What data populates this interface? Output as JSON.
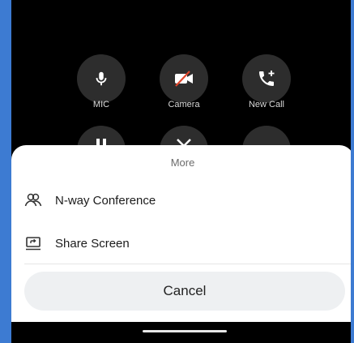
{
  "call_controls": [
    {
      "label": "MIC",
      "icon": "mic-icon"
    },
    {
      "label": "Camera",
      "icon": "camera-off-icon"
    },
    {
      "label": "New Call",
      "icon": "add-call-icon"
    }
  ],
  "sheet": {
    "title": "More",
    "options": [
      {
        "label": "N-way Conference",
        "icon": "conference-icon"
      },
      {
        "label": "Share Screen",
        "icon": "share-screen-icon"
      }
    ],
    "cancel_label": "Cancel"
  },
  "colors": {
    "background": "#000000",
    "button_bg": "#2d2d2d",
    "camera_slash": "#e0452b",
    "sheet_bg": "#ffffff",
    "cancel_bg": "#eef0f2",
    "frame": "#3d7bd2"
  }
}
